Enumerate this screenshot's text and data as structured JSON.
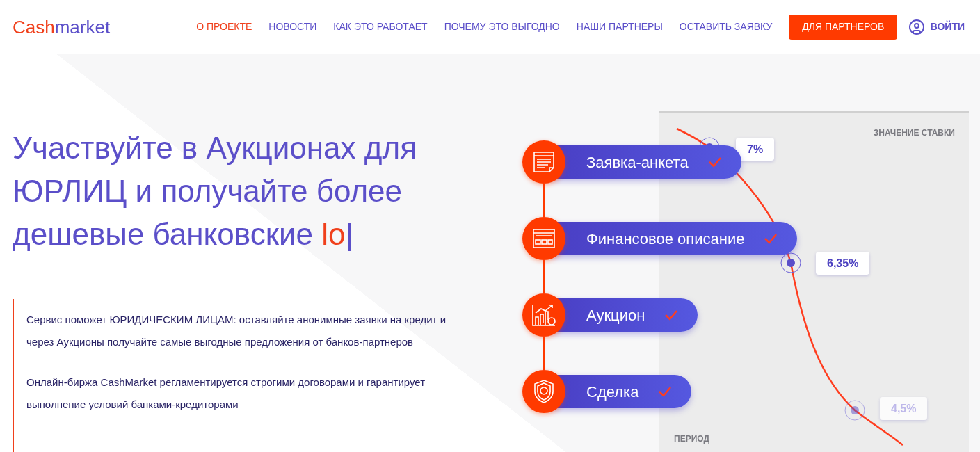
{
  "header": {
    "logo": {
      "part_1": "Cash",
      "part_2": "market"
    },
    "nav": [
      {
        "label": "О ПРОЕКТЕ",
        "selected": true
      },
      {
        "label": "НОВОСТИ",
        "selected": false
      },
      {
        "label": "КАК ЭТО РАБОТАЕТ",
        "selected": false
      },
      {
        "label": "ПОЧЕМУ ЭТО ВЫГОДНО",
        "selected": false
      },
      {
        "label": "НАШИ ПАРТНЕРЫ",
        "selected": false
      },
      {
        "label": "ОСТАВИТЬ ЗАЯВКУ",
        "selected": false
      }
    ],
    "partners_button": "ДЛЯ ПАРТНЕРОВ",
    "login": "ВОЙТИ"
  },
  "hero": {
    "headline": "Участвуйте в Аукционах для ЮРЛИЦ и получайте более дешевые банковские",
    "typed_word": "lo",
    "cursor": "|",
    "paragraphs": [
      "Сервис поможет ЮРИДИЧЕСКИМ ЛИЦАМ: оставляйте анонимные заявки на кредит и через Аукционы получайте самые выгодные предложения от банков-партнеров",
      "Онлайн-биржа CashMarket регламентируется строгими договорами и гарантирует выполнение условий банками-кредиторами"
    ]
  },
  "steps": [
    {
      "kind": "form",
      "label": "Заявка-анкета",
      "checked": true
    },
    {
      "kind": "finance",
      "label": "Финансовое описание",
      "checked": true
    },
    {
      "kind": "auction",
      "label": "Аукцион",
      "checked": true
    },
    {
      "kind": "deal",
      "label": "Сделка",
      "checked": true
    }
  ],
  "rate_panel": {
    "y_label": "ЗНАЧЕНИЕ СТАВКИ",
    "x_label": "ПЕРИОД",
    "points": [
      {
        "label": "7%",
        "faded": false
      },
      {
        "label": "6,35%",
        "faded": false
      },
      {
        "label": "4,5%",
        "faded": true
      }
    ]
  }
}
